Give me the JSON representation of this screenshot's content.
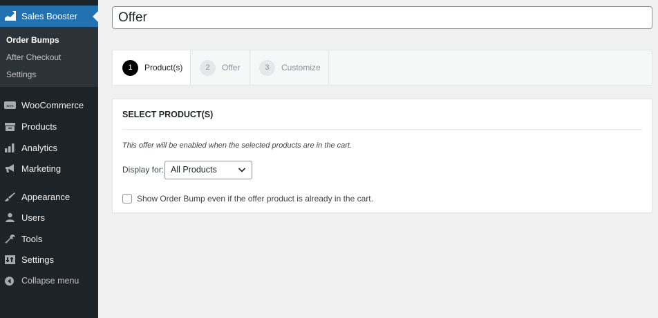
{
  "sidebar": {
    "current": {
      "label": "Sales Booster",
      "icon": "chart-icon"
    },
    "submenu": [
      {
        "label": "Order Bumps",
        "active": true
      },
      {
        "label": "After Checkout",
        "active": false
      },
      {
        "label": "Settings",
        "active": false
      }
    ],
    "items": [
      {
        "label": "WooCommerce",
        "icon": "woo-icon"
      },
      {
        "label": "Products",
        "icon": "archive-icon"
      },
      {
        "label": "Analytics",
        "icon": "bar-chart-icon"
      },
      {
        "label": "Marketing",
        "icon": "megaphone-icon"
      },
      {
        "label": "Appearance",
        "icon": "brush-icon"
      },
      {
        "label": "Users",
        "icon": "user-icon"
      },
      {
        "label": "Tools",
        "icon": "wrench-icon"
      },
      {
        "label": "Settings",
        "icon": "settings-icon"
      },
      {
        "label": "Collapse menu",
        "icon": "collapse-icon"
      }
    ]
  },
  "title_input": {
    "value": "Offer"
  },
  "tabs": [
    {
      "num": "1",
      "label": "Product(s)",
      "active": true
    },
    {
      "num": "2",
      "label": "Offer",
      "active": false
    },
    {
      "num": "3",
      "label": "Customize",
      "active": false
    }
  ],
  "panel": {
    "title": "SELECT PRODUCT(S)",
    "description": "This offer will be enabled when the selected products are in the cart.",
    "display_for_label": "Display for:",
    "display_for_value": "All Products",
    "checkbox_label": "Show Order Bump even if the offer product is already in the cart."
  },
  "colors": {
    "accent": "#2271b1",
    "sidebar_bg": "#1d2327",
    "submenu_bg": "#2c3338"
  }
}
